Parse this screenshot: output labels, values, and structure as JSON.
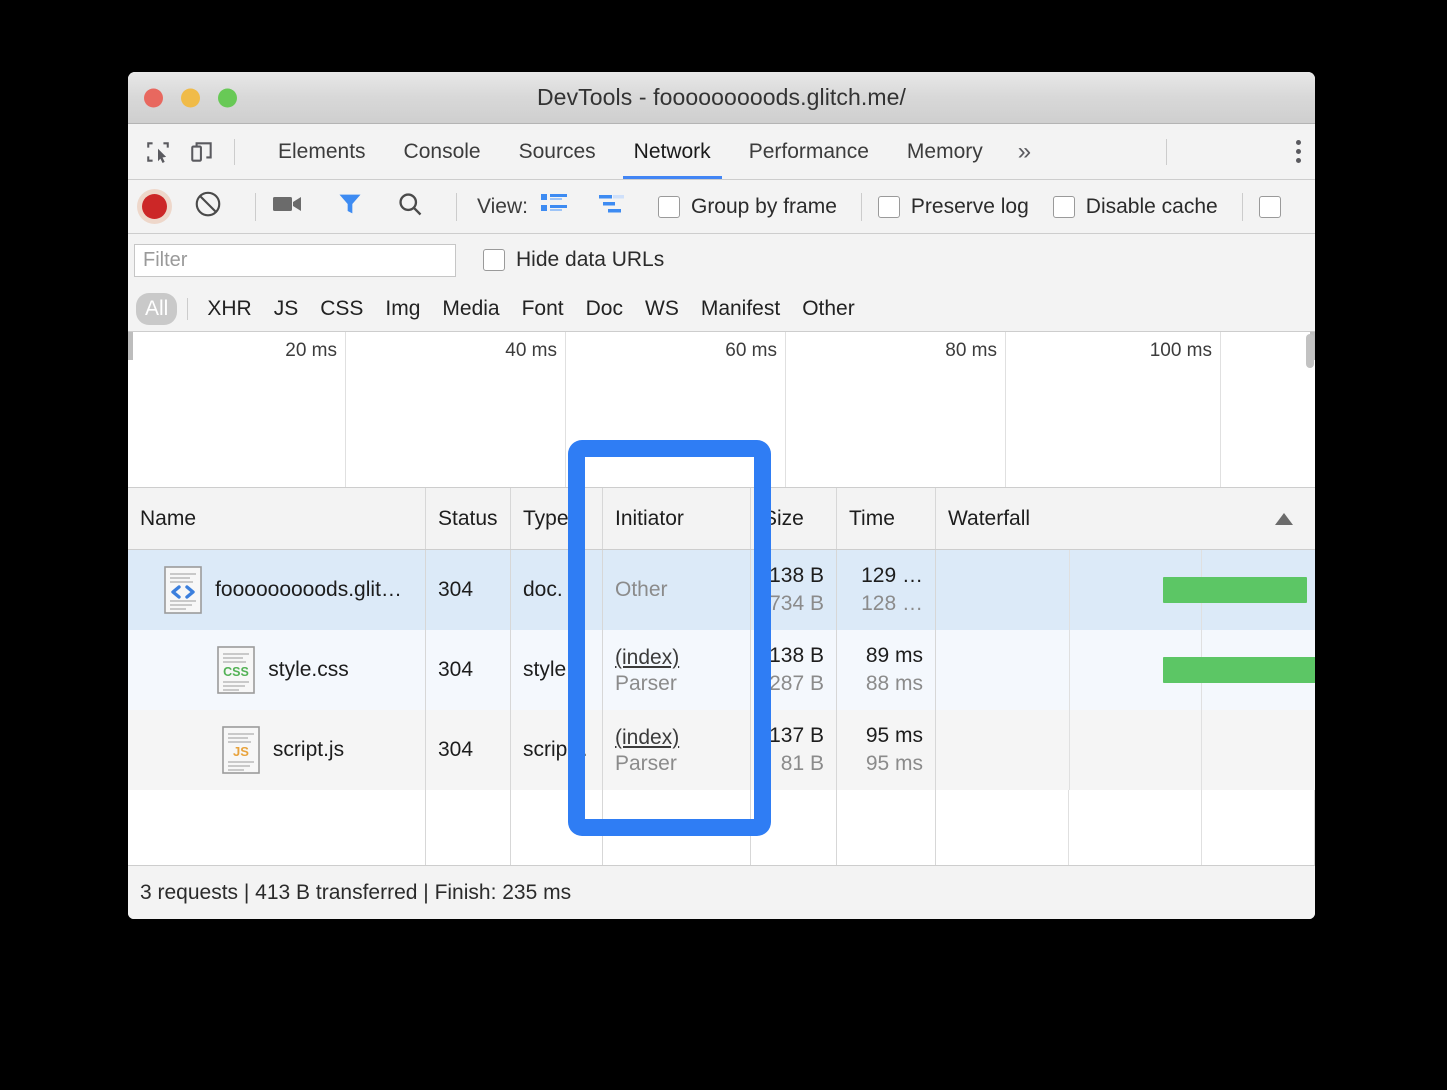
{
  "window": {
    "title": "DevTools - fooooooooods.glitch.me/",
    "traffic_lights": [
      "close-red",
      "minimize-yellow",
      "zoom-green"
    ]
  },
  "tabstrip": {
    "inspect_icon": "inspect-element-icon",
    "device_icon": "device-toolbar-icon",
    "tabs": [
      {
        "label": "Elements",
        "active": false
      },
      {
        "label": "Console",
        "active": false
      },
      {
        "label": "Sources",
        "active": false
      },
      {
        "label": "Network",
        "active": true
      },
      {
        "label": "Performance",
        "active": false
      },
      {
        "label": "Memory",
        "active": false
      }
    ],
    "more_label": "»",
    "menu_icon": "kebab-menu-icon"
  },
  "network_toolbar": {
    "record_icon": "record-button-icon",
    "clear_icon": "clear-icon",
    "capture_screenshots_icon": "camera-icon",
    "filter_icon": "funnel-filter-icon",
    "search_icon": "search-magnifier-icon",
    "view_label": "View:",
    "view_large_rows_icon": "large-request-rows-icon",
    "view_overview_icon": "waterfall-overview-icon",
    "checkboxes": [
      {
        "label": "Group by frame",
        "checked": false
      },
      {
        "label": "Preserve log",
        "checked": false
      },
      {
        "label": "Disable cache",
        "checked": false
      },
      {
        "label": "",
        "checked": false
      }
    ]
  },
  "filter_row": {
    "filter_placeholder": "Filter",
    "filter_value": "",
    "hide_data_urls_label": "Hide data URLs",
    "hide_data_urls_checked": false
  },
  "type_filters": {
    "items": [
      "All",
      "XHR",
      "JS",
      "CSS",
      "Img",
      "Media",
      "Font",
      "Doc",
      "WS",
      "Manifest",
      "Other"
    ],
    "selected": "All"
  },
  "overview": {
    "ticks": [
      "20 ms",
      "40 ms",
      "60 ms",
      "80 ms",
      "100 ms"
    ]
  },
  "grid": {
    "columns": [
      "Name",
      "Status",
      "Type",
      "Initiator",
      "Size",
      "Time",
      "Waterfall"
    ],
    "sort_indicator": "ascending-triangle",
    "rows": [
      {
        "icon": "html-document-icon",
        "name": "fooooooooods.glit…",
        "status": "304",
        "type": "doc.",
        "initiator_primary": "Other",
        "initiator_primary_link": false,
        "initiator_secondary": "",
        "size_primary": "138 B",
        "size_secondary": "734 B",
        "time_primary": "129 …",
        "time_secondary": "128 …",
        "bar_color": "#5cc665",
        "bar_start_pct": 60,
        "bar_width_pct": 38
      },
      {
        "icon": "css-stylesheet-icon",
        "name": "style.css",
        "status": "304",
        "type": "style…",
        "initiator_primary": "(index)",
        "initiator_primary_link": true,
        "initiator_secondary": "Parser",
        "size_primary": "138 B",
        "size_secondary": "287 B",
        "time_primary": "89 ms",
        "time_secondary": "88 ms",
        "bar_color": "#5cc665",
        "bar_start_pct": 60,
        "bar_width_pct": 45
      },
      {
        "icon": "javascript-file-icon",
        "name": "script.js",
        "status": "304",
        "type": "scrip…",
        "initiator_primary": "(index)",
        "initiator_primary_link": true,
        "initiator_secondary": "Parser",
        "size_primary": "137 B",
        "size_secondary": "81 B",
        "time_primary": "95 ms",
        "time_secondary": "95 ms",
        "bar_color": "",
        "bar_start_pct": 0,
        "bar_width_pct": 0
      }
    ]
  },
  "status_bar": {
    "text": "3 requests | 413 B transferred | Finish: 235 ms"
  },
  "annotation": {
    "shape": "rounded-rectangle-highlight",
    "color": "#2f7df4",
    "target": "Initiator column"
  }
}
